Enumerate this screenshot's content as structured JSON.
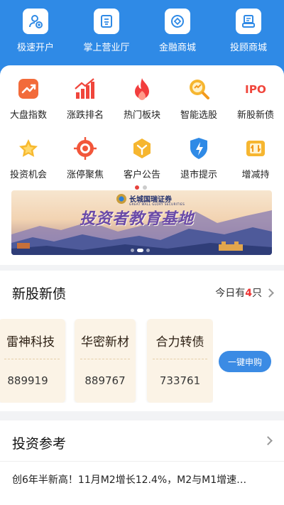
{
  "colors": {
    "header_blue": "#2f8ae6",
    "accent_red": "#e33333",
    "button_blue": "#3b8be4"
  },
  "top_nav": [
    {
      "label": "极速开户",
      "icon": "user-plus-icon"
    },
    {
      "label": "掌上营业厅",
      "icon": "document-icon"
    },
    {
      "label": "金融商城",
      "icon": "coin-icon"
    },
    {
      "label": "投顾商城",
      "icon": "advisor-icon"
    }
  ],
  "grid_row1": [
    {
      "label": "大盘指数",
      "icon": "trend-chart-icon"
    },
    {
      "label": "涨跌排名",
      "icon": "bar-rank-icon"
    },
    {
      "label": "热门板块",
      "icon": "fire-icon"
    },
    {
      "label": "智能选股",
      "icon": "smart-search-icon"
    },
    {
      "label": "新股新债",
      "icon": "ipo-icon",
      "badge": "IPO"
    }
  ],
  "grid_row2": [
    {
      "label": "投资机会",
      "icon": "star-icon"
    },
    {
      "label": "涨停聚焦",
      "icon": "target-icon"
    },
    {
      "label": "客户公告",
      "icon": "notice-icon"
    },
    {
      "label": "退市提示",
      "icon": "lightning-shield-icon"
    },
    {
      "label": "增减持",
      "icon": "swap-icon"
    }
  ],
  "banner": {
    "brand": "长城国瑞证券",
    "brand_en": "GREAT WALL GLORY SECURITIES",
    "title": "投资者教育基地"
  },
  "ipo": {
    "title": "新股新债",
    "today_prefix": "今日有",
    "today_count": "4",
    "today_suffix": "只",
    "stocks": [
      {
        "name": "雷神科技",
        "code": "889919"
      },
      {
        "name": "华密新材",
        "code": "889767"
      },
      {
        "name": "合力转债",
        "code": "733761"
      }
    ],
    "subscribe_label": "一键申购"
  },
  "reference": {
    "title": "投资参考",
    "headline": "创6年半新高！11月M2增长12.4%，M2与M1增速…"
  }
}
